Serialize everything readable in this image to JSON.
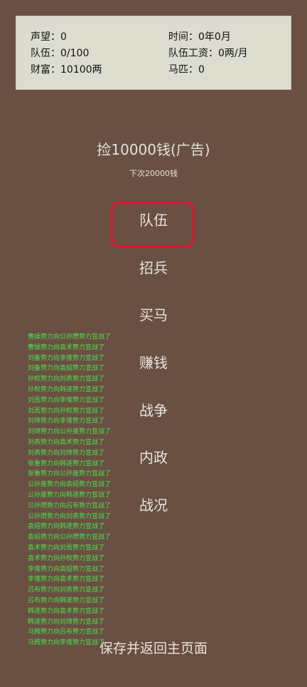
{
  "stats": {
    "prestige": "声望：0",
    "time": "时间：0年0月",
    "team": "队伍：0/100",
    "wage": "队伍工资：0两/月",
    "wealth": "财富：10100两",
    "horses": "马匹：0"
  },
  "ad": {
    "button_label": "捡10000钱(广告)",
    "next_text": "下次20000钱"
  },
  "menu": {
    "team": "队伍",
    "recruit": "招兵",
    "buy_horse": "买马",
    "earn_money": "赚钱",
    "war": "战争",
    "domestic": "内政",
    "battle_status": "战况"
  },
  "highlight_color": "#e0142a",
  "log_color": "#4be14b",
  "log": [
    "曹操势力向公孙瓒势力宣战了",
    "曹操势力向袁术势力宣战了",
    "刘备势力向李傕势力宣战了",
    "刘备势力向袁绍势力宣战了",
    "孙权势力向刘表势力宣战了",
    "孙权势力向韩遂势力宣战了",
    "刘焉势力向李傕势力宣战了",
    "刘焉势力向孙权势力宣战了",
    "刘璋势力向李傕势力宣战了",
    "刘璋势力向公孙度势力宣战了",
    "刘表势力向袁术势力宣战了",
    "刘表势力向刘璋势力宣战了",
    "张鲁势力向韩遂势力宣战了",
    "张鲁势力向公孙度势力宣战了",
    "公孙度势力向袁绍势力宣战了",
    "公孙度势力向韩遂势力宣战了",
    "公孙瓒势力向吕布势力宣战了",
    "公孙瓒势力向刘表势力宣战了",
    "袁绍势力向韩遂势力宣战了",
    "袁绍势力向公孙瓒势力宣战了",
    "袁术势力向刘焉势力宣战了",
    "袁术势力向孙权势力宣战了",
    "李傕势力向袁绍势力宣战了",
    "李傕势力向袁术势力宣战了",
    "吕布势力向刘表势力宣战了",
    "吕布势力向韩遂势力宣战了",
    "韩遂势力向袁术势力宣战了",
    "韩遂势力向刘璋势力宣战了",
    "马腾势力向吕布势力宣战了",
    "马腾势力向李傕势力宣战了"
  ],
  "footer": {
    "save_label": "保存并返回主页面"
  }
}
